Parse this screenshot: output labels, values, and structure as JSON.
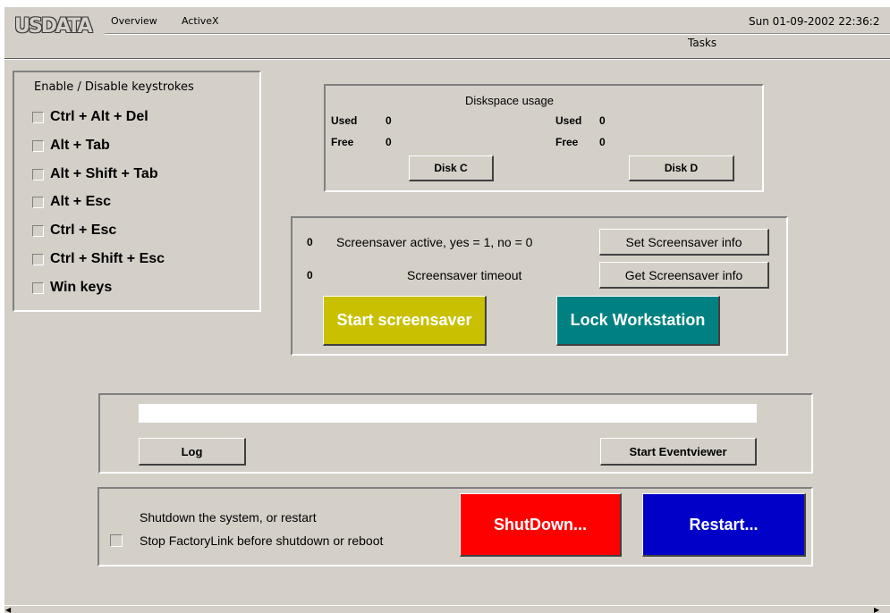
{
  "header": {
    "logo": "USDATA",
    "menu": [
      "Overview",
      "ActiveX"
    ],
    "datetime": "Sun 01-09-2002 22:36:2",
    "tasks_label": "Tasks"
  },
  "keystrokes": {
    "title": "Enable / Disable keystrokes",
    "items": [
      {
        "label": "Ctrl + Alt + Del",
        "checked": false
      },
      {
        "label": "Alt + Tab",
        "checked": false
      },
      {
        "label": "Alt + Shift + Tab",
        "checked": false
      },
      {
        "label": "Alt + Esc",
        "checked": false
      },
      {
        "label": "Ctrl + Esc",
        "checked": false
      },
      {
        "label": "Ctrl + Shift + Esc",
        "checked": false
      },
      {
        "label": "Win keys",
        "checked": false
      }
    ]
  },
  "disk": {
    "title": "Diskspace usage",
    "c": {
      "used_label": "Used",
      "used_value": "0",
      "free_label": "Free",
      "free_value": "0",
      "button": "Disk C"
    },
    "d": {
      "used_label": "Used",
      "used_value": "0",
      "free_label": "Free",
      "free_value": "0",
      "button": "Disk D"
    }
  },
  "screensaver": {
    "active_value": "0",
    "active_label": "Screensaver active, yes = 1, no = 0",
    "timeout_value": "0",
    "timeout_label": "Screensaver timeout",
    "set_button": "Set Screensaver info",
    "get_button": "Get Screensaver info",
    "start_button": "Start screensaver",
    "lock_button": "Lock Workstation"
  },
  "log": {
    "field_value": "",
    "log_button": "Log",
    "eventviewer_button": "Start Eventviewer"
  },
  "shutdown": {
    "text": "Shutdown the system, or restart",
    "stop_label": "Stop FactoryLink before shutdown or reboot",
    "stop_checked": false,
    "shutdown_button": "ShutDown...",
    "restart_button": "Restart..."
  },
  "colors": {
    "background": "#d4d0c8",
    "start_screensaver": "#c8c000",
    "lock_workstation": "#008080",
    "shutdown": "#ff0000",
    "restart": "#0000c8"
  },
  "icons": {
    "scroll_left": "triangle-left-icon",
    "scroll_right": "triangle-right-icon"
  }
}
